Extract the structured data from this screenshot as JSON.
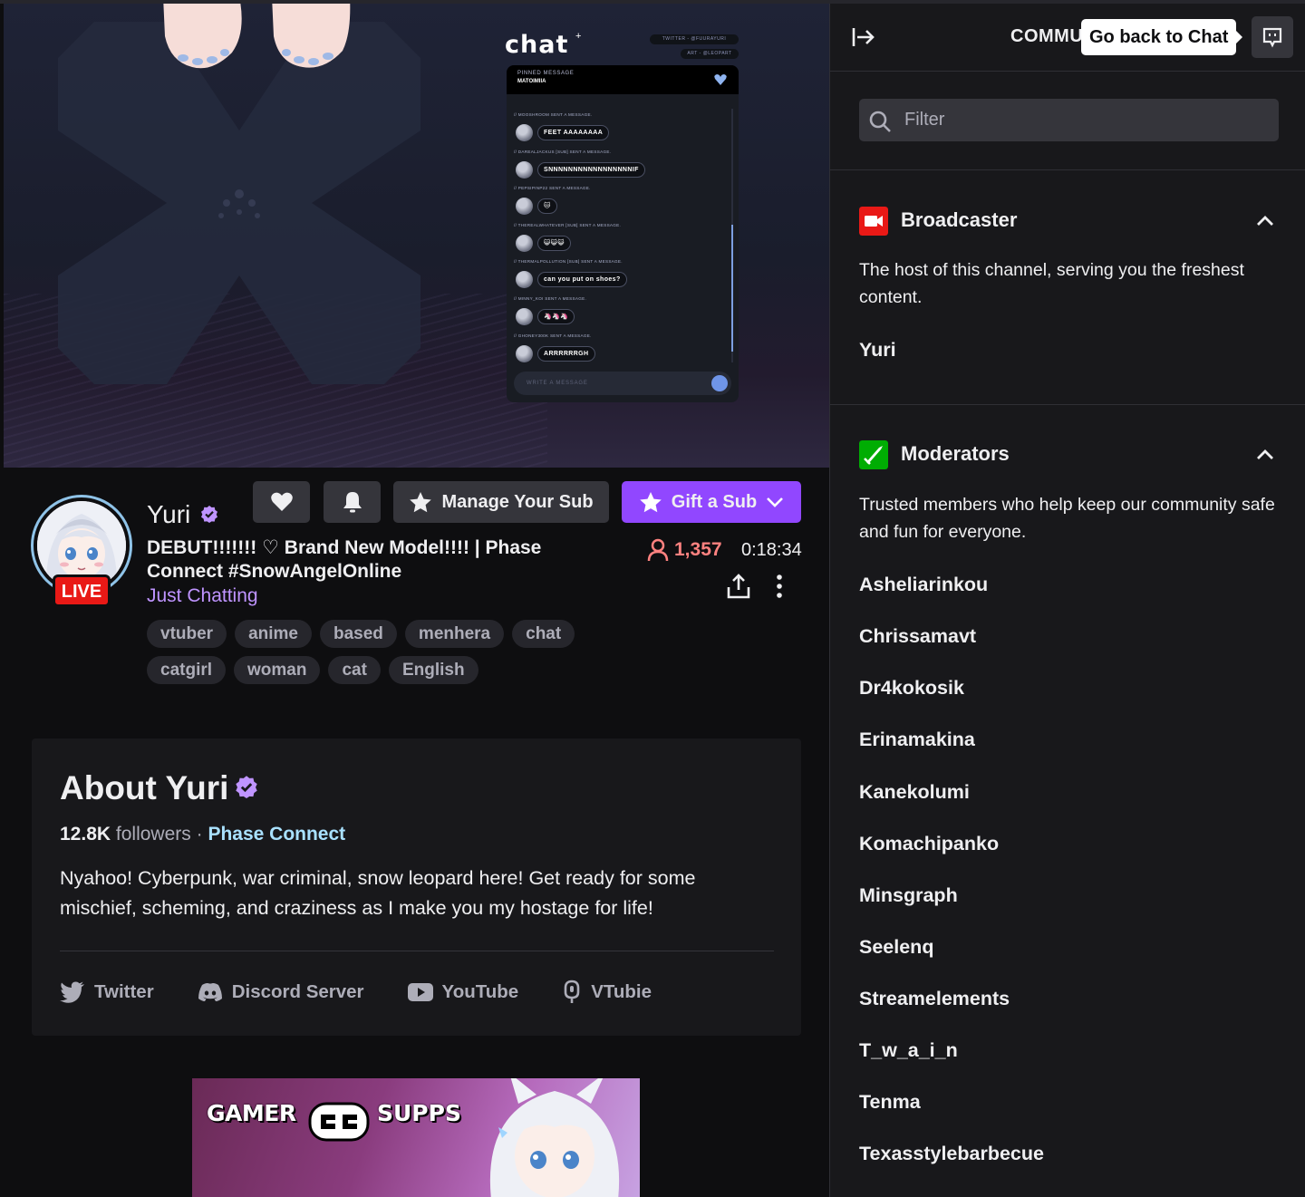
{
  "player": {
    "overlay_title": "chat",
    "overlay_sup": "+",
    "overlay_twitter": "TWITTER - @FUURAYURI",
    "overlay_art": "ART - @LEOPART",
    "pinned_label": "PINNED MESSAGE",
    "pinned_text": "MATOIMIIA",
    "chat_messages": [
      {
        "user": "// MOOSHROOM SENT A MESSAGE.",
        "text": "FEET AAAAAAAA"
      },
      {
        "user": "// DAREALJACKUS [SUB] SENT A MESSAGE.",
        "text": "SNNNNNNNNNNNNNNNNNIF"
      },
      {
        "user": "// PEPSIPINP22 SENT A MESSAGE.",
        "text": "🐱"
      },
      {
        "user": "// THEREALWHATEVER [SUB] SENT A MESSAGE.",
        "text": "😺😺😺"
      },
      {
        "user": "// THERMALPOLLUTION [SUB] SENT A MESSAGE.",
        "text": "can you put on shoes?"
      },
      {
        "user": "// MINNY_KOI SENT A MESSAGE.",
        "text": "🦄🦄🦄"
      },
      {
        "user": "// GHONEY300K SENT A MESSAGE.",
        "text": "ARRRRRRGH"
      }
    ],
    "input_placeholder": "WRITE A MESSAGE"
  },
  "channel": {
    "name": "Yuri",
    "live_label": "LIVE",
    "stream_title": "DEBUT!!!!!!! ♡ Brand New Model!!!! | Phase Connect #SnowAngelOnline",
    "category": "Just Chatting",
    "viewers": "1,357",
    "uptime": "0:18:34",
    "manage_sub_label": "Manage Your Sub",
    "gift_sub_label": "Gift a Sub",
    "tags": [
      "vtuber",
      "anime",
      "based",
      "menhera",
      "chat",
      "catgirl",
      "woman",
      "cat",
      "English"
    ]
  },
  "about": {
    "title": "About Yuri",
    "followers_count": "12.8K",
    "followers_label": "followers",
    "separator": "·",
    "team": "Phase Connect",
    "description": "Nyahoo! Cyberpunk, war criminal, snow leopard here! Get ready for some mischief, scheming, and craziness as I make you my hostage for life!",
    "links": [
      {
        "label": "Twitter",
        "icon": "twitter-icon"
      },
      {
        "label": "Discord Server",
        "icon": "discord-icon"
      },
      {
        "label": "YouTube",
        "icon": "youtube-icon"
      },
      {
        "label": "VTubie",
        "icon": "vtubie-icon"
      }
    ]
  },
  "panel": {
    "brand_left": "GAMER",
    "brand_right": "SUPPS"
  },
  "community": {
    "header_label": "COMMU",
    "tooltip": "Go back to Chat",
    "filter_placeholder": "Filter",
    "broadcaster": {
      "title": "Broadcaster",
      "description": "The host of this channel, serving you the freshest content.",
      "members": [
        "Yuri"
      ]
    },
    "moderators": {
      "title": "Moderators",
      "description": "Trusted members who help keep our community safe and fun for everyone.",
      "members": [
        "Asheliarinkou",
        "Chrissamavt",
        "Dr4kokosik",
        "Erinamakina",
        "Kanekolumi",
        "Komachipanko",
        "Minsgraph",
        "Seelenq",
        "Streamelements",
        "T_w_a_i_n",
        "Tenma",
        "Texasstylebarbecue"
      ]
    }
  },
  "colors": {
    "accent_purple": "#9147ff",
    "live_red": "#e91916",
    "viewer_red": "#ff8280",
    "category_purple": "#bf94ff",
    "team_blue": "#a9e1ff",
    "moderator_green": "#00ad03",
    "broadcaster_red": "#e91916"
  }
}
